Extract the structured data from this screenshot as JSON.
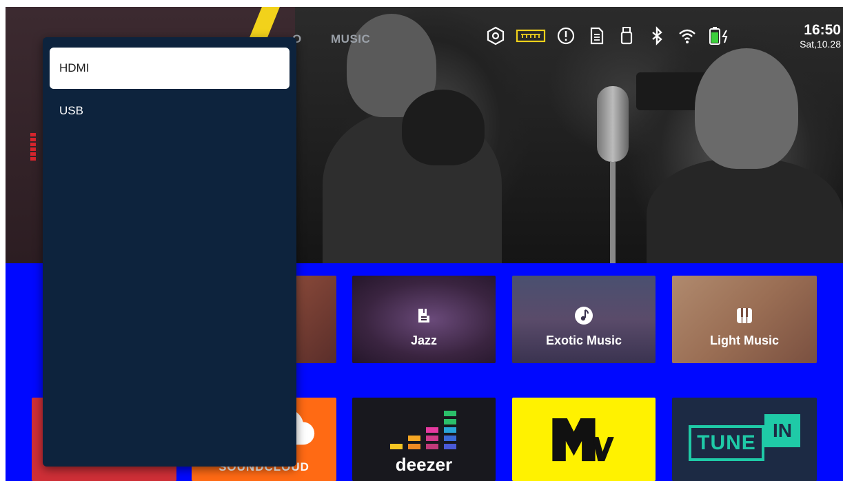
{
  "source_menu": {
    "items": [
      {
        "label": "HDMI",
        "selected": true
      },
      {
        "label": "USB",
        "selected": false
      }
    ]
  },
  "top_nav": {
    "partial_tab": "O",
    "music_tab": "MUSIC"
  },
  "status_bar": {
    "icons": [
      "settings-hex-icon",
      "hdmi-port-icon",
      "alert-icon",
      "sd-card-icon",
      "usb-icon",
      "bluetooth-icon",
      "wifi-icon",
      "battery-charging-icon"
    ],
    "time": "16:50",
    "date": "Sat,10.28"
  },
  "categories": [
    {
      "label": "Jazz",
      "icon": "guitar-icon"
    },
    {
      "label": "Exotic Music",
      "icon": "music-note-icon"
    },
    {
      "label": "Light Music",
      "icon": "piano-icon"
    }
  ],
  "apps": [
    {
      "label": "SOUNDCLOUD",
      "brand_color": "#ff6a14"
    },
    {
      "label": "deezer",
      "brand_color": "#18181e"
    },
    {
      "label": "MTV",
      "brand_color": "#fff200"
    },
    {
      "label": "TUNE",
      "label2": "IN",
      "brand_color": "#1fcaa7"
    }
  ],
  "colors": {
    "accent_blue": "#0008ff",
    "panel_bg": "#0d233d",
    "stripe_yellow": "#f2d21b"
  }
}
